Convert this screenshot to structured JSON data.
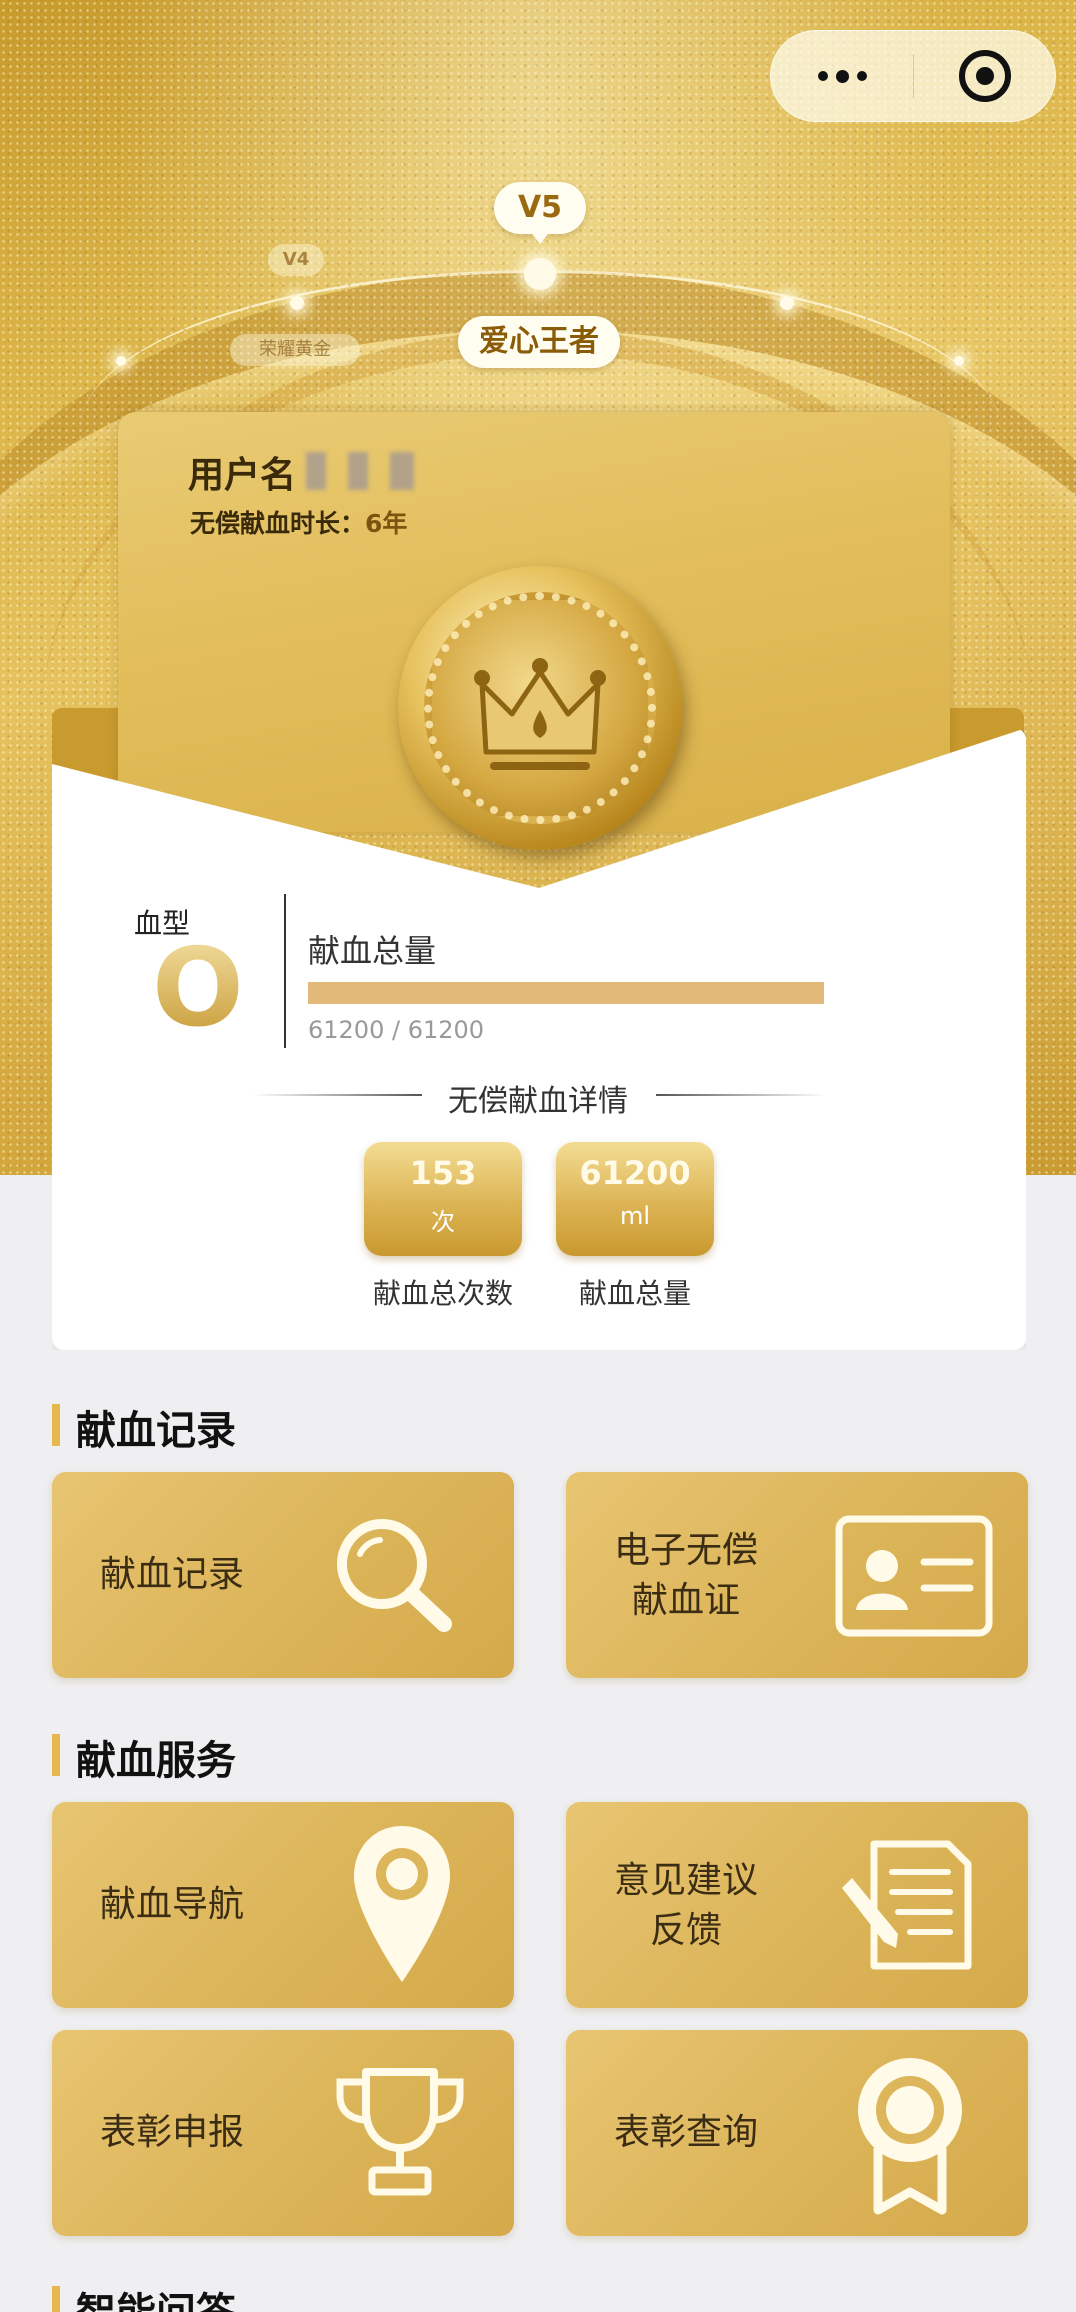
{
  "capsule": {
    "more_icon": "more-dots-icon",
    "close_icon": "target-close-icon"
  },
  "levels": {
    "current_tag": "V5",
    "prev_tag": "V4",
    "current_name": "爱心王者",
    "prev_name": "荣耀黄金"
  },
  "user": {
    "name_label": "用户名",
    "duration_label": "无偿献血时长：",
    "duration_value": "6年"
  },
  "blood": {
    "type_label": "血型",
    "type_value": "O",
    "total_label": "献血总量",
    "progress_text": "61200 / 61200",
    "progress_fraction": 1.0
  },
  "details": {
    "title": "无偿献血详情",
    "stats": [
      {
        "value": "153",
        "unit": "次",
        "label": "献血总次数"
      },
      {
        "value": "61200",
        "unit": "ml",
        "label": "献血总量"
      }
    ]
  },
  "sections": [
    {
      "title": "献血记录",
      "tiles": [
        {
          "label": "献血记录",
          "icon": "magnifier-icon"
        },
        {
          "label_line1": "电子无偿",
          "label_line2": "献血证",
          "icon": "id-card-icon"
        }
      ]
    },
    {
      "title": "献血服务",
      "tiles": [
        {
          "label": "献血导航",
          "icon": "location-pin-icon"
        },
        {
          "label_line1": "意见建议",
          "label_line2": "反馈",
          "icon": "document-pen-icon"
        },
        {
          "label": "表彰申报",
          "icon": "trophy-icon"
        },
        {
          "label": "表彰查询",
          "icon": "award-ribbon-icon"
        }
      ]
    },
    {
      "title": "智能问答"
    }
  ],
  "colors": {
    "gold": "#dcb548",
    "accent_bar": "#e7b84f",
    "progress": "#e3b979"
  }
}
